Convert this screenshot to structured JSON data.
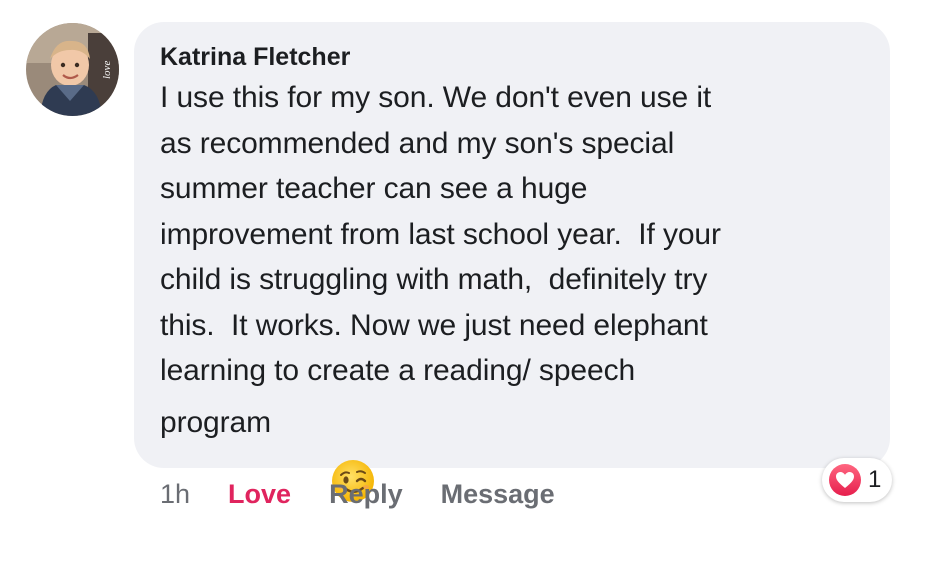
{
  "comment": {
    "author": "Katrina Fletcher",
    "lines": [
      "I use this for my son. We don't even use it",
      "as recommended and my son's special",
      "summer teacher can see a huge",
      "improvement from last school year.  If your",
      "child is struggling with math,  definitely try",
      "this.  It works. Now we just need elephant",
      "learning to create a reading/ speech",
      "program"
    ],
    "emoji": "winking-face",
    "avatar_overlay_text": "love"
  },
  "actions": {
    "timestamp": "1h",
    "love_label": "Love",
    "reply_label": "Reply",
    "message_label": "Message"
  },
  "reactions": {
    "type": "love-heart",
    "count": "1"
  },
  "colors": {
    "bubble_bg": "#f0f1f5",
    "love_accent": "#e0245e",
    "muted_text": "#6a6d73",
    "heart_red": "#f33e58"
  }
}
